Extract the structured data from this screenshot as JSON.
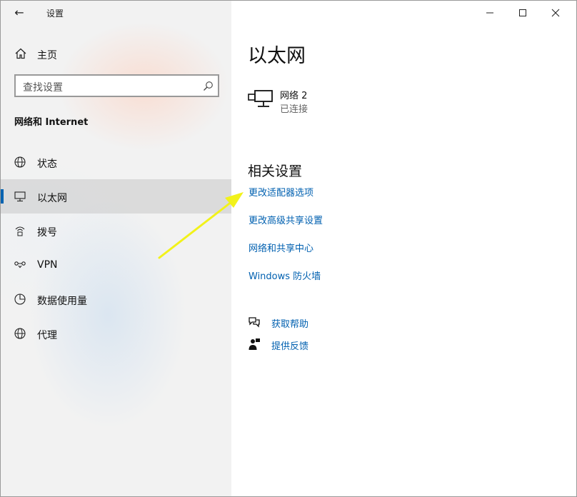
{
  "titlebar": {
    "back_glyph": "←",
    "title": "设置",
    "controls": [
      "minimize-icon",
      "maximize-icon",
      "close-icon"
    ]
  },
  "sidebar": {
    "home_label": "主页",
    "search_placeholder": "查找设置",
    "section_title": "网络和 Internet",
    "items": [
      {
        "label": "状态",
        "icon": "globe-status-icon"
      },
      {
        "label": "以太网",
        "icon": "ethernet-icon",
        "selected": true
      },
      {
        "label": "拨号",
        "icon": "dialup-icon"
      },
      {
        "label": "VPN",
        "icon": "vpn-icon"
      },
      {
        "label": "数据使用量",
        "icon": "data-usage-icon"
      },
      {
        "label": "代理",
        "icon": "globe-proxy-icon"
      }
    ]
  },
  "main": {
    "title": "以太网",
    "adapter": {
      "name": "网络 2",
      "status": "已连接",
      "icon": "network-adapter-icon"
    },
    "related_title": "相关设置",
    "links": [
      "更改适配器选项",
      "更改高级共享设置",
      "网络和共享中心",
      "Windows 防火墙"
    ],
    "help": [
      {
        "label": "获取帮助",
        "icon": "help-chat-icon"
      },
      {
        "label": "提供反馈",
        "icon": "feedback-icon"
      }
    ]
  },
  "colors": {
    "accent": "#0063b1",
    "link": "#0060b0",
    "annotation_arrow": "#f2f21a"
  }
}
